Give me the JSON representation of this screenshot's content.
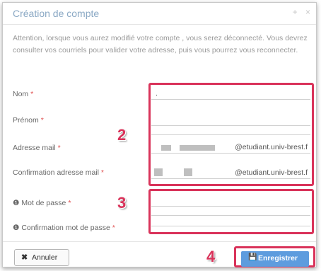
{
  "dialog": {
    "title": "Création de compte",
    "expand_icon": "+",
    "close_icon": "×",
    "notice": "Attention, lorsque vous aurez modifié votre compte , vous serez déconnecté. Vous devrez consulter vos courriels pour valider votre adresse, puis vous pourrez vous reconnecter."
  },
  "form": {
    "required_mark": "*",
    "info_icon": "❶",
    "nom_label": "Nom",
    "nom_value": ".",
    "prenom_label": "Prénom",
    "email_label": "Adresse mail",
    "email_suffix": "@etudiant.univ-brest.f",
    "email_confirm_label": "Confirmation adresse mail",
    "email_confirm_suffix": "@etudiant.univ-brest.f",
    "password_label": "Mot de passe",
    "password_confirm_label": "Confirmation mot de passe"
  },
  "annotations": {
    "marker_2": "2",
    "marker_3": "3",
    "marker_4": "4"
  },
  "footer": {
    "cancel_label": "Annuler",
    "cancel_icon": "✖",
    "save_label": "Enregistrer",
    "save_icon": "💾"
  },
  "colors": {
    "annotation": "#d9335a",
    "primary_button": "#5d9cde",
    "title": "#8aa8c4"
  }
}
